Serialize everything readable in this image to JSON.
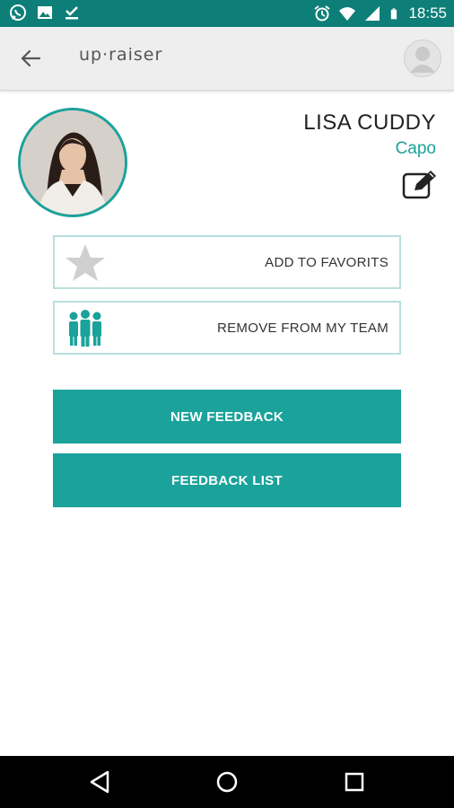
{
  "status_bar": {
    "time": "18:55"
  },
  "app_bar": {
    "logo_text": "up·raiser"
  },
  "profile": {
    "name": "LISA CUDDY",
    "role": "Capo"
  },
  "actions": {
    "add_favorites": "ADD TO FAVORITS",
    "remove_team": "REMOVE FROM MY TEAM"
  },
  "buttons": {
    "new_feedback": "NEW FEEDBACK",
    "feedback_list": "FEEDBACK LIST"
  },
  "colors": {
    "accent": "#1aa29b",
    "status_bar": "#0d7f78",
    "app_bar": "#eeeeee",
    "nav_bar": "#000000"
  },
  "icons": [
    "whatsapp-icon",
    "image-icon",
    "download-done-icon",
    "alarm-icon",
    "wifi-icon",
    "signal-icon",
    "battery-icon",
    "back-arrow-icon",
    "account-icon",
    "edit-icon",
    "star-icon",
    "team-icon",
    "nav-back-icon",
    "nav-home-icon",
    "nav-recents-icon"
  ]
}
